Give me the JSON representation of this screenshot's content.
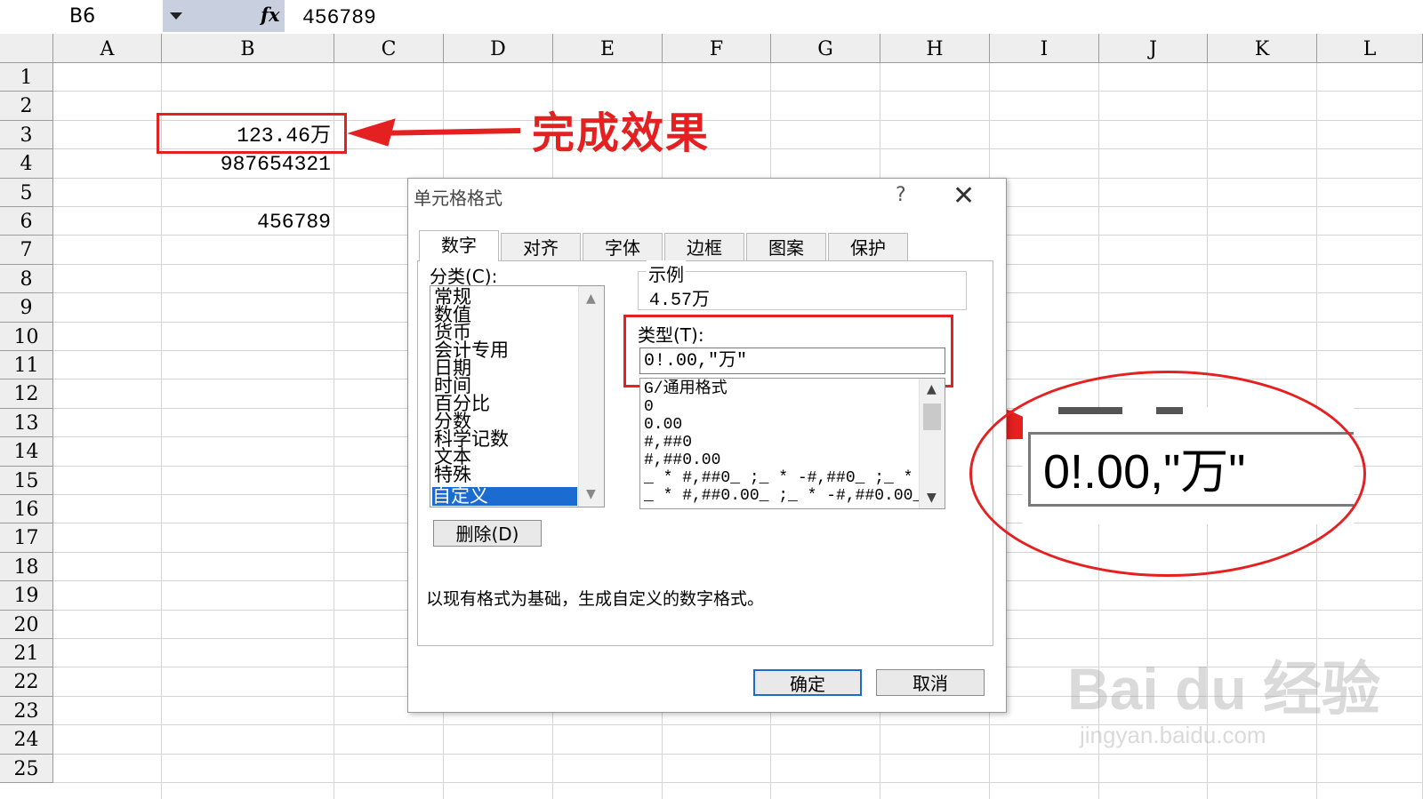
{
  "formula_bar": {
    "name_box": "B6",
    "fx": "fx",
    "value": "456789"
  },
  "columns": [
    "A",
    "B",
    "C",
    "D",
    "E",
    "F",
    "G",
    "H",
    "I",
    "J",
    "K",
    "L"
  ],
  "rows": [
    "1",
    "2",
    "3",
    "4",
    "5",
    "6",
    "7",
    "8",
    "9",
    "10",
    "11",
    "12",
    "13",
    "14",
    "15",
    "16",
    "17",
    "18",
    "19",
    "20",
    "21",
    "22",
    "23",
    "24",
    "25"
  ],
  "cells": {
    "B3": "123.46万",
    "B4": "987654321",
    "B6": "456789"
  },
  "annotation": {
    "text": "完成效果",
    "color": "#e52020"
  },
  "dialog": {
    "title": "单元格格式",
    "help": "?",
    "close": "✕",
    "tabs": [
      "数字",
      "对齐",
      "字体",
      "边框",
      "图案",
      "保护"
    ],
    "category_label": "分类(C):",
    "categories": [
      "常规",
      "数值",
      "货币",
      "会计专用",
      "日期",
      "时间",
      "百分比",
      "分数",
      "科学记数",
      "文本",
      "特殊",
      "自定义"
    ],
    "selected_category": "自定义",
    "sample_label": "示例",
    "sample_value": "4.57万",
    "type_label": "类型(T):",
    "type_value": "0!.00,\"万\"",
    "format_list": [
      "G/通用格式",
      "0",
      "0.00",
      "#,##0",
      "#,##0.00",
      "_ * #,##0_ ;_ * -#,##0_ ;_ * \"",
      "_ * #,##0.00_ ;_ * -#,##0.00_"
    ],
    "delete_button": "删除(D)",
    "description": "以现有格式为基础，生成自定义的数字格式。",
    "ok_button": "确定",
    "cancel_button": "取消"
  },
  "zoom": {
    "text": "0!.00,\"万\""
  },
  "watermark": {
    "brand": "Bai du 经验",
    "url": "jingyan.baidu.com"
  }
}
